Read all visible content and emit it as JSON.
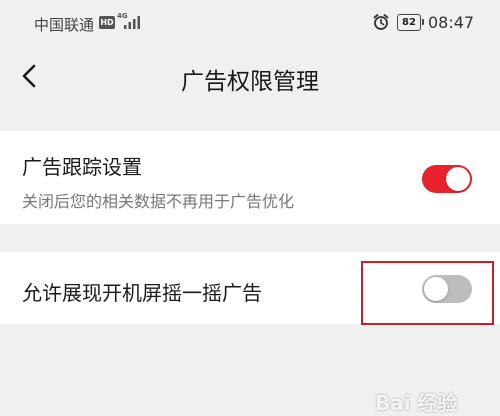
{
  "status_bar": {
    "carrier": "中国联通",
    "hd_badge": "HD",
    "network": "4G",
    "battery": "82",
    "time": "08:47",
    "icons": [
      "signal-icon",
      "alarm-icon",
      "battery-icon"
    ]
  },
  "header": {
    "back_icon": "chevron-left-icon",
    "title": "广告权限管理"
  },
  "settings": [
    {
      "title": "广告跟踪设置",
      "description": "关闭后您的相关数据不再用于广告优化",
      "enabled": true
    },
    {
      "title": "允许展现开机屏摇一摇广告",
      "enabled": false
    }
  ],
  "watermark": "Bai 经验",
  "colors": {
    "accent": "#e8222c",
    "toggle_off": "#bdbdbd",
    "highlight": "#c6212a",
    "background": "#f0f0f0"
  }
}
